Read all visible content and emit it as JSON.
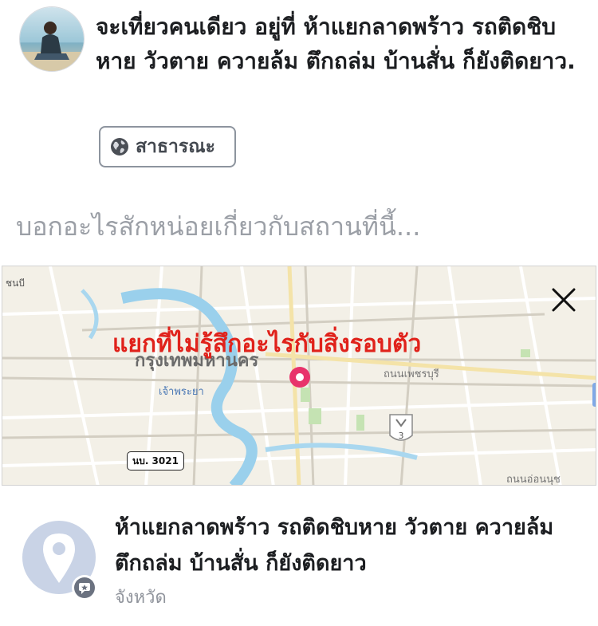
{
  "post": {
    "text": "จะเที่ยวคนเดียว อยู่ที่ ห้าแยกลาดพร้าว รถติดชิบหาย วัวตาย ควายล้ม ตึกถล่ม บ้านสั่น ก็ยังติดยาว.",
    "privacy_label": "สาธารณะ",
    "privacy_icon": "globe-icon"
  },
  "composer": {
    "placeholder": "บอกอะไรสักหน่อยเกี่ยวกับสถานที่นี้..."
  },
  "map": {
    "overlay_text": "แยกที่ไม่รู้สึกอะไรกับสิ่งรอบตัว",
    "city_label": "กรุงเทพมหานคร",
    "district_label": "เจ้าพระยา",
    "road_label_1": "ถนนเพชรบุรี",
    "road_label_2": "ถนนอ่อนนุช",
    "edge_label": "ชนบี",
    "road_badge": "นบ. 3021",
    "shield_number": "3",
    "close_icon": "close-icon",
    "pin_icon": "map-pin-icon",
    "pin_color": "#e8336b",
    "overlay_color": "#e0221b"
  },
  "place": {
    "name": "ห้าแยกลาดพร้าว รถติดชิบหาย วัวตาย ควายล้ม ตึกถล่ม บ้านสั่น ก็ยังติดยาว",
    "category": "จังหวัด",
    "icon": "location-pin-icon",
    "badge_icon": "star-badge-icon"
  }
}
